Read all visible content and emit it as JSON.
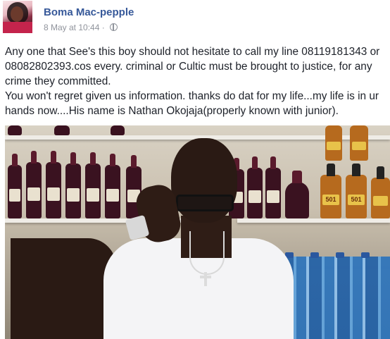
{
  "author": {
    "name": "Boma Mac-pepple",
    "timestamp": "8 May at 10:44",
    "separator": "·",
    "audience_icon": "globe-icon"
  },
  "post": {
    "paragraph_1": "Any one that See's this boy should not hesitate to call my line 08119181343 or 08082802393.cos every. criminal or Cultic must be brought to justice, for any crime they committed.",
    "paragraph_2": "You won't regret given us information. thanks do dat for my life...my life is in ur hands now....His name is Nathan Okojaja(properly known with junior)."
  },
  "photo": {
    "bottle_label": "501"
  },
  "colors": {
    "name_link": "#365899",
    "meta_text": "#90949c",
    "body_text": "#1d2129"
  }
}
